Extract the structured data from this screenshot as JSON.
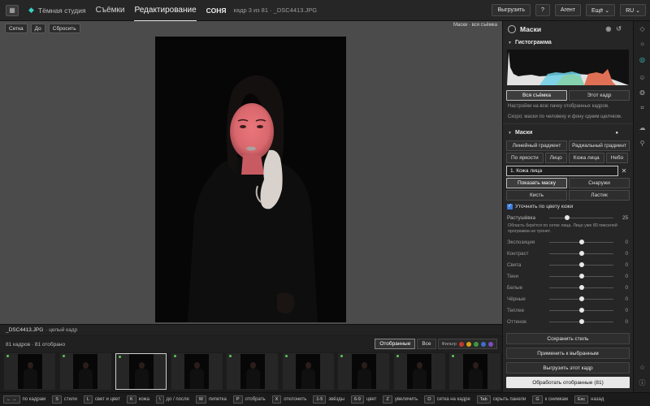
{
  "topbar": {
    "brand": "Тёмная студия",
    "tabs": [
      "Съёмки",
      "Редактирование"
    ],
    "active_tab": "Редактирование",
    "session": "СОНЯ",
    "frame_info": "кадр 3 из 81 · _DSC4413.JPG",
    "export_btn": "Выгрузить",
    "help_btn": "?",
    "agent_btn": "Агент",
    "more_btn": "Ещё ⌄",
    "lang_btn": "RU ⌄"
  },
  "canvas": {
    "grid_btn": "Сетка",
    "before_btn": "До",
    "reset_btn": "Сбросить",
    "mask_label": "Маски · вся съёмка"
  },
  "panel": {
    "title": "Маски",
    "histogram_title": "Гистограмма",
    "scope_all": "Вся съёмка",
    "scope_this": "Этот кадр",
    "scope_note": "Настройки на всю пачку отобранных кадров.",
    "masks_note": "Скоро: маски по человеку и фону одним щелчком.",
    "masks_title": "Маски",
    "mask_types_row1": [
      "Линейный градиент",
      "Радиальный градиент"
    ],
    "mask_types_row2": [
      "По яркости",
      "Лицо",
      "Кожа лица",
      "Небо"
    ],
    "active_mask": "1. Кожа лица",
    "show_mask": "Показать маску",
    "outside": "Снаружи",
    "brush": "Кисть",
    "eraser": "Ластик",
    "refine_label": "Уточнить по цвету кожи",
    "feather": {
      "label": "Растушёвка",
      "value": "25",
      "level": 0.28
    },
    "feather_note": "Область берётся по сетке лица. Лицо уже 80 пикселей программа не тронет.",
    "sliders": [
      {
        "label": "Экспозиция",
        "value": "0"
      },
      {
        "label": "Контраст",
        "value": "0"
      },
      {
        "label": "Света",
        "value": "0"
      },
      {
        "label": "Тени",
        "value": "0"
      },
      {
        "label": "Белые",
        "value": "0"
      },
      {
        "label": "Чёрные",
        "value": "0"
      },
      {
        "label": "Теплее",
        "value": "0"
      },
      {
        "label": "Оттенок",
        "value": "0"
      }
    ],
    "save_style": "Сохранить стиль",
    "apply_selected": "Применить к выбранным",
    "export_frame": "Выгрузить этот кадр",
    "process_selected": "Обработать отобранные (81)"
  },
  "filmstrip_info": {
    "filename": "_DSC4413.JPG",
    "mode": "· целый кадр",
    "count": "81 кадров · 81 отобрано",
    "tab_selected": "Отобранные",
    "tab_all": "Все",
    "filter_label": "Фильтр",
    "filter_colors": [
      "#c0392b",
      "#d4a017",
      "#3c9a3c",
      "#3b6fd1",
      "#7a4fbf"
    ]
  },
  "statusbar": [
    {
      "key": "← →",
      "label": "по кадрам"
    },
    {
      "key": "S",
      "label": "стили"
    },
    {
      "key": "L",
      "label": "свет и цвет"
    },
    {
      "key": "K",
      "label": "кожа"
    },
    {
      "key": "\\",
      "label": "до / после"
    },
    {
      "key": "W",
      "label": "пипетка"
    },
    {
      "key": "P",
      "label": "отобрать"
    },
    {
      "key": "X",
      "label": "отклонить"
    },
    {
      "key": "1-5",
      "label": "звёзды"
    },
    {
      "key": "6-9",
      "label": "цвет"
    },
    {
      "key": "Z",
      "label": "увеличить"
    },
    {
      "key": "O",
      "label": "сетка на кадре"
    },
    {
      "key": "Tab",
      "label": "скрыть панели"
    },
    {
      "key": "G",
      "label": "к снимкам"
    },
    {
      "key": "Esc",
      "label": "назад"
    }
  ],
  "colors": {
    "accent": "#3ad1c5",
    "checkbox": "#3b7de2",
    "skin_mask": "#e46a6a"
  }
}
